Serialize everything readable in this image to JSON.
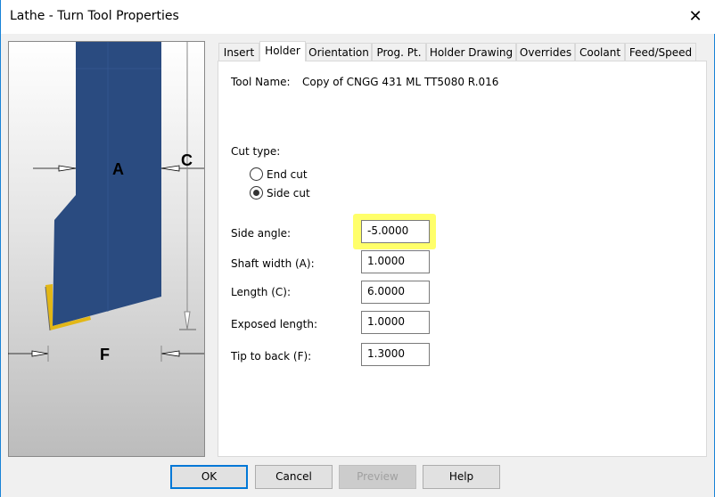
{
  "window": {
    "title": "Lathe - Turn Tool Properties",
    "close_icon": "close-icon"
  },
  "drawing": {
    "labels": {
      "a": "A",
      "c": "C",
      "f": "F"
    },
    "colors": {
      "holder": "#2a4b80",
      "insert": "#e2b717"
    }
  },
  "tabs": [
    {
      "label": "Insert"
    },
    {
      "label": "Holder",
      "active": true
    },
    {
      "label": "Orientation"
    },
    {
      "label": "Prog. Pt."
    },
    {
      "label": "Holder Drawing"
    },
    {
      "label": "Overrides"
    },
    {
      "label": "Coolant"
    },
    {
      "label": "Feed/Speed"
    }
  ],
  "holder": {
    "tool_name_label": "Tool Name:",
    "tool_name": "Copy of CNGG 431 ML TT5080  R.016",
    "cut_type_label": "Cut type:",
    "cut_types": [
      {
        "label": "End cut",
        "selected": false
      },
      {
        "label": "Side cut",
        "selected": true
      }
    ],
    "fields": [
      {
        "label": "Side angle:",
        "value": "-5.0000",
        "highlighted": true
      },
      {
        "label": "Shaft width (A):",
        "value": "1.0000"
      },
      {
        "label": "Length (C):",
        "value": "6.0000"
      },
      {
        "label": "Exposed length:",
        "value": "1.0000"
      },
      {
        "label": "Tip to back (F):",
        "value": "1.3000"
      }
    ]
  },
  "buttons": {
    "ok": "OK",
    "cancel": "Cancel",
    "preview": "Preview",
    "help": "Help"
  }
}
